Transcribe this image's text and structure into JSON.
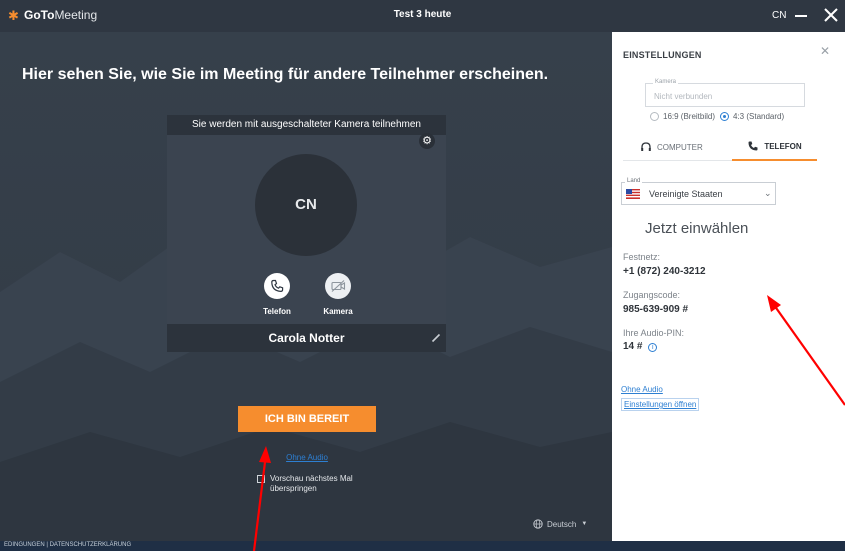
{
  "titlebar": {
    "brand_bold": "GoTo",
    "brand_light": "Meeting",
    "meeting_title": "Test 3 heute",
    "user_initials": "CN"
  },
  "main": {
    "headline": "Hier sehen Sie, wie Sie im Meeting für andere Teilnehmer erscheinen.",
    "preview": {
      "banner": "Sie werden mit ausgeschalteter Kamera teilnehmen",
      "avatar_initials": "CN",
      "phone_label": "Telefon",
      "camera_label": "Kamera",
      "participant_name": "Carola Notter"
    },
    "ready_button": "ICH BIN BEREIT",
    "no_audio_link": "Ohne Audio",
    "skip_preview_label": "Vorschau nächstes Mal überspringen",
    "language": "Deutsch"
  },
  "settings": {
    "title": "EINSTELLUNGEN",
    "camera_legend": "Kamera",
    "camera_value": "Nicht verbunden",
    "aspect_options": [
      "16:9 (Breitbild)",
      "4:3 (Standard)"
    ],
    "selected_aspect": "4:3 (Standard)",
    "tabs": [
      {
        "label": "COMPUTER",
        "active": false
      },
      {
        "label": "TELEFON",
        "active": true
      }
    ],
    "country_legend": "Land",
    "country_value": "Vereinigte Staaten",
    "dial_in_title": "Jetzt einwählen",
    "landline_label": "Festnetz:",
    "landline_value": "+1 (872) 240-3212",
    "access_code_label": "Zugangscode:",
    "access_code_value": "985-639-909 #",
    "audio_pin_label": "Ihre Audio-PIN:",
    "audio_pin_value": "14 #",
    "no_audio_link": "Ohne Audio",
    "open_settings_link": "Einstellungen öffnen"
  },
  "footer": {
    "links": "EDINGUNGEN | DATENSCHUTZERKLÄRUNG"
  },
  "colors": {
    "accent_orange": "#f68d2e",
    "link_blue": "#2d7fd2",
    "window_bg": "#353e49",
    "annotation_red": "#ff0000"
  }
}
